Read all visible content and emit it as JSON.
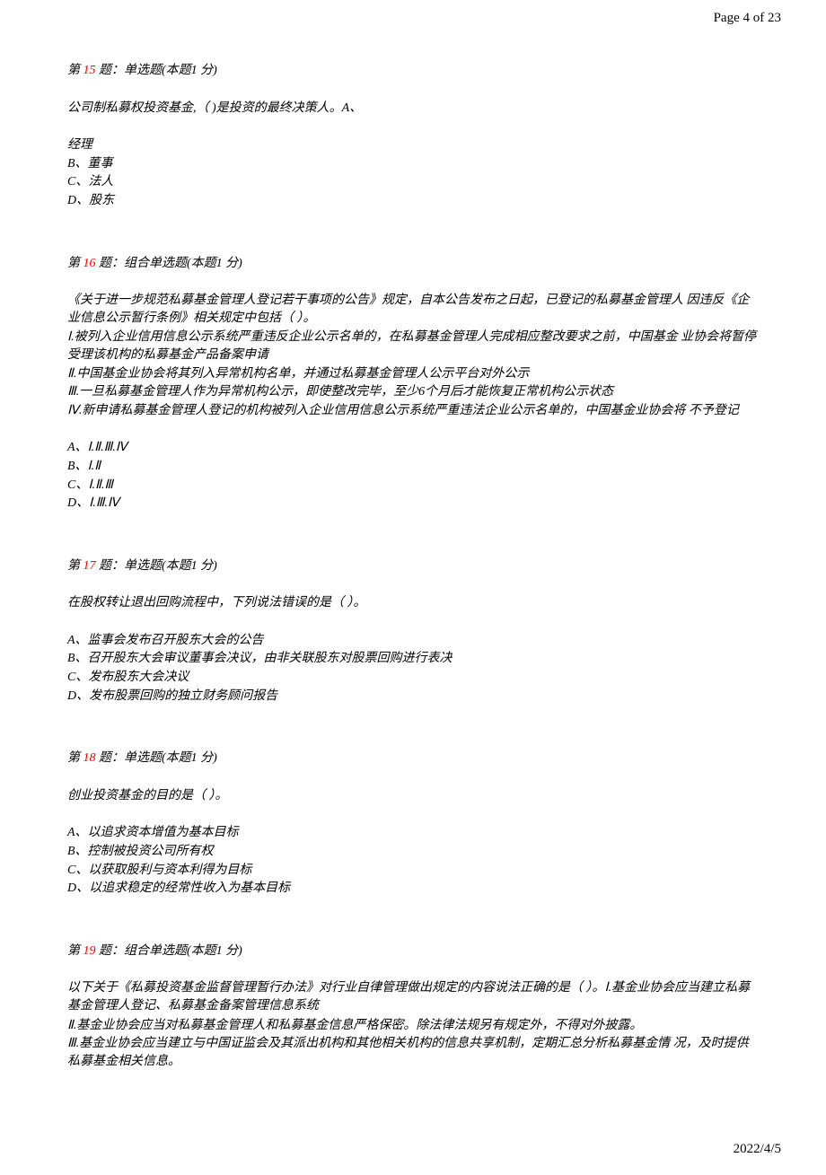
{
  "header": {
    "page_marker": "Page 4 of 23"
  },
  "footer": {
    "date": "2022/4/5"
  },
  "questions": [
    {
      "heading_prefix": "第 ",
      "number": "15",
      "heading_suffix": " 题：单选题(本题1 分)",
      "stem": "公司制私募权投资基金,（ )是投资的最终决策人。A、",
      "pre_option": "经理",
      "options": [
        "B、董事",
        "C、法人",
        "D、股东"
      ]
    },
    {
      "heading_prefix": "第 ",
      "number": "16",
      "heading_suffix": " 题：组合单选题(本题1 分)",
      "stem": "《关于进一步规范私募基金管理人登记若干事项的公告》规定，自本公告发布之日起，已登记的私募基金管理人  因违反《企业信息公示暂行条例》相关规定中包括（  ）。",
      "statements": [
        "Ⅰ.被列入企业信用信息公示系统严重违反企业公示名单的，在私募基金管理人完成相应整改要求之前，中国基金  业协会将暂停受理该机构的私募基金产品备案申请",
        "Ⅱ.中国基金业协会将其列入异常机构名单，并通过私募基金管理人公示平台对外公示",
        "Ⅲ.一旦私募基金管理人作为异常机构公示，即使整改完毕，至少6个月后才能恢复正常机构公示状态",
        "Ⅳ.新申请私募基金管理人登记的机构被列入企业信用信息公示系统严重违法企业公示名单的，中国基金业协会将  不予登记"
      ],
      "options": [
        "A、Ⅰ.Ⅱ.Ⅲ.Ⅳ",
        "B、Ⅰ.Ⅱ",
        "C、Ⅰ.Ⅱ.Ⅲ",
        "D、Ⅰ.Ⅲ.Ⅳ"
      ]
    },
    {
      "heading_prefix": "第 ",
      "number": "17",
      "heading_suffix": " 题：单选题(本题1 分)",
      "stem": "在股权转让退出回购流程中，下列说法错误的是（  ）。",
      "options": [
        "A、监事会发布召开股东大会的公告",
        "B、召开股东大会审议董事会决议，由非关联股东对股票回购进行表决",
        "C、发布股东大会决议",
        "D、发布股票回购的独立财务顾问报告"
      ]
    },
    {
      "heading_prefix": "第 ",
      "number": "18",
      "heading_suffix": " 题：单选题(本题1 分)",
      "stem": "创业投资基金的目的是（  ）。",
      "options": [
        "A、以追求资本增值为基本目标",
        "B、控制被投资公司所有权",
        "C、以获取股利与资本利得为目标",
        "D、以追求稳定的经常性收入为基本目标"
      ]
    },
    {
      "heading_prefix": "第 ",
      "number": "19",
      "heading_suffix": " 题：组合单选题(本题1 分)",
      "stem": "以下关于《私募投资基金监督管理暂行办法》对行业自律管理做出规定的内容说法正确的是（   ）。Ⅰ.基金业协会应当建立私募基金管理人登记、私募基金备案管理信息系统",
      "statements": [
        "Ⅱ.基金业协会应当对私募基金管理人和私募基金信息严格保密。除法律法规另有规定外，不得对外披露。",
        "Ⅲ.基金业协会应当建立与中国证监会及其派出机构和其他相关机构的信息共享机制，定期汇总分析私募基金情  况，及时提供私募基金相关信息。"
      ],
      "options": []
    }
  ]
}
